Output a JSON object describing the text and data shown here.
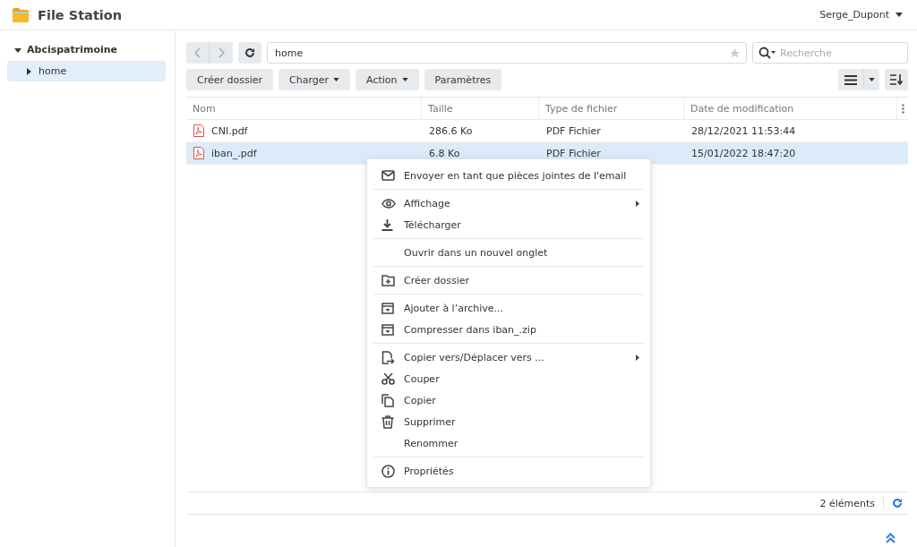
{
  "window": {
    "title": "File Station",
    "user": "Serge_Dupont"
  },
  "sidebar": {
    "root": {
      "label": "Abcispatrimoine",
      "expanded": true,
      "children": [
        {
          "label": "home",
          "expanded": false,
          "selected": true
        }
      ]
    }
  },
  "toolbar": {
    "path": "home",
    "search": {
      "placeholder": "Recherche"
    },
    "buttons": [
      {
        "label": "Créer dossier",
        "dropdown": false
      },
      {
        "label": "Charger",
        "dropdown": true
      },
      {
        "label": "Action",
        "dropdown": true
      },
      {
        "label": "Paramètres",
        "dropdown": false
      }
    ]
  },
  "table": {
    "columns": [
      "Nom",
      "Taille",
      "Type de fichier",
      "Date de modification"
    ],
    "rows": [
      {
        "name": "CNI.pdf",
        "size": "286.6 Ko",
        "type": "PDF Fichier",
        "modified": "28/12/2021 11:53:44",
        "selected": false
      },
      {
        "name": "iban_.pdf",
        "size": "6.8 Ko",
        "type": "PDF Fichier",
        "modified": "15/01/2022 18:47:20",
        "selected": true
      }
    ]
  },
  "context_menu": [
    [
      {
        "label": "Envoyer en tant que pièces jointes de l'email",
        "submenu": false
      }
    ],
    [
      {
        "label": "Affichage",
        "submenu": true
      },
      {
        "label": "Télécharger",
        "submenu": false
      }
    ],
    [
      {
        "label": "Ouvrir dans un nouvel onglet",
        "submenu": false
      }
    ],
    [
      {
        "label": "Créer dossier",
        "submenu": false
      }
    ],
    [
      {
        "label": "Ajouter à l’archive...",
        "submenu": false
      },
      {
        "label": "Compresser dans iban_.zip",
        "submenu": false
      }
    ],
    [
      {
        "label": "Copier vers/Déplacer vers ...",
        "submenu": true
      },
      {
        "label": "Couper",
        "submenu": false
      },
      {
        "label": "Copier",
        "submenu": false
      },
      {
        "label": "Supprimer",
        "submenu": false
      },
      {
        "label": "Renommer",
        "submenu": false
      }
    ],
    [
      {
        "label": "Propriétés",
        "submenu": false
      }
    ]
  ],
  "status_bar": {
    "count": "2 éléments"
  }
}
